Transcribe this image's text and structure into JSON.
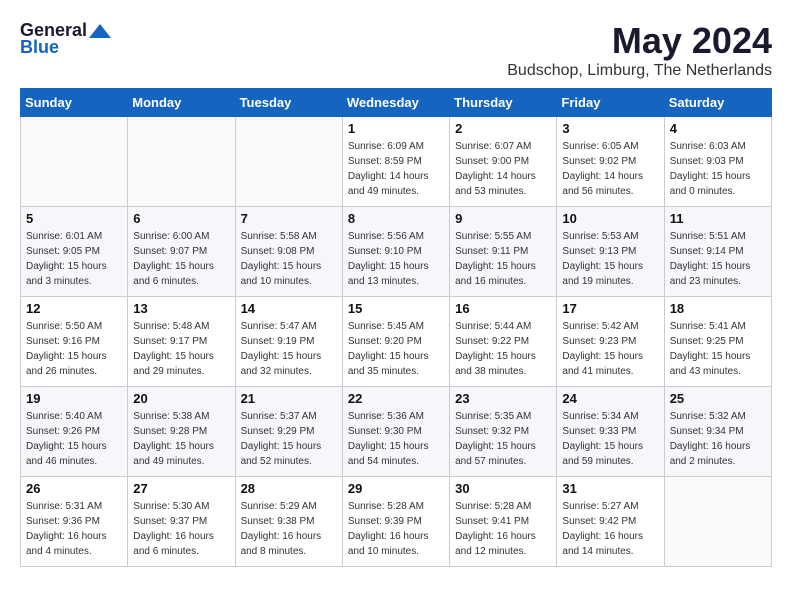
{
  "header": {
    "logo_general": "General",
    "logo_blue": "Blue",
    "month_title": "May 2024",
    "location": "Budschop, Limburg, The Netherlands"
  },
  "days_of_week": [
    "Sunday",
    "Monday",
    "Tuesday",
    "Wednesday",
    "Thursday",
    "Friday",
    "Saturday"
  ],
  "weeks": [
    [
      {
        "day": "",
        "info": ""
      },
      {
        "day": "",
        "info": ""
      },
      {
        "day": "",
        "info": ""
      },
      {
        "day": "1",
        "info": "Sunrise: 6:09 AM\nSunset: 8:59 PM\nDaylight: 14 hours\nand 49 minutes."
      },
      {
        "day": "2",
        "info": "Sunrise: 6:07 AM\nSunset: 9:00 PM\nDaylight: 14 hours\nand 53 minutes."
      },
      {
        "day": "3",
        "info": "Sunrise: 6:05 AM\nSunset: 9:02 PM\nDaylight: 14 hours\nand 56 minutes."
      },
      {
        "day": "4",
        "info": "Sunrise: 6:03 AM\nSunset: 9:03 PM\nDaylight: 15 hours\nand 0 minutes."
      }
    ],
    [
      {
        "day": "5",
        "info": "Sunrise: 6:01 AM\nSunset: 9:05 PM\nDaylight: 15 hours\nand 3 minutes."
      },
      {
        "day": "6",
        "info": "Sunrise: 6:00 AM\nSunset: 9:07 PM\nDaylight: 15 hours\nand 6 minutes."
      },
      {
        "day": "7",
        "info": "Sunrise: 5:58 AM\nSunset: 9:08 PM\nDaylight: 15 hours\nand 10 minutes."
      },
      {
        "day": "8",
        "info": "Sunrise: 5:56 AM\nSunset: 9:10 PM\nDaylight: 15 hours\nand 13 minutes."
      },
      {
        "day": "9",
        "info": "Sunrise: 5:55 AM\nSunset: 9:11 PM\nDaylight: 15 hours\nand 16 minutes."
      },
      {
        "day": "10",
        "info": "Sunrise: 5:53 AM\nSunset: 9:13 PM\nDaylight: 15 hours\nand 19 minutes."
      },
      {
        "day": "11",
        "info": "Sunrise: 5:51 AM\nSunset: 9:14 PM\nDaylight: 15 hours\nand 23 minutes."
      }
    ],
    [
      {
        "day": "12",
        "info": "Sunrise: 5:50 AM\nSunset: 9:16 PM\nDaylight: 15 hours\nand 26 minutes."
      },
      {
        "day": "13",
        "info": "Sunrise: 5:48 AM\nSunset: 9:17 PM\nDaylight: 15 hours\nand 29 minutes."
      },
      {
        "day": "14",
        "info": "Sunrise: 5:47 AM\nSunset: 9:19 PM\nDaylight: 15 hours\nand 32 minutes."
      },
      {
        "day": "15",
        "info": "Sunrise: 5:45 AM\nSunset: 9:20 PM\nDaylight: 15 hours\nand 35 minutes."
      },
      {
        "day": "16",
        "info": "Sunrise: 5:44 AM\nSunset: 9:22 PM\nDaylight: 15 hours\nand 38 minutes."
      },
      {
        "day": "17",
        "info": "Sunrise: 5:42 AM\nSunset: 9:23 PM\nDaylight: 15 hours\nand 41 minutes."
      },
      {
        "day": "18",
        "info": "Sunrise: 5:41 AM\nSunset: 9:25 PM\nDaylight: 15 hours\nand 43 minutes."
      }
    ],
    [
      {
        "day": "19",
        "info": "Sunrise: 5:40 AM\nSunset: 9:26 PM\nDaylight: 15 hours\nand 46 minutes."
      },
      {
        "day": "20",
        "info": "Sunrise: 5:38 AM\nSunset: 9:28 PM\nDaylight: 15 hours\nand 49 minutes."
      },
      {
        "day": "21",
        "info": "Sunrise: 5:37 AM\nSunset: 9:29 PM\nDaylight: 15 hours\nand 52 minutes."
      },
      {
        "day": "22",
        "info": "Sunrise: 5:36 AM\nSunset: 9:30 PM\nDaylight: 15 hours\nand 54 minutes."
      },
      {
        "day": "23",
        "info": "Sunrise: 5:35 AM\nSunset: 9:32 PM\nDaylight: 15 hours\nand 57 minutes."
      },
      {
        "day": "24",
        "info": "Sunrise: 5:34 AM\nSunset: 9:33 PM\nDaylight: 15 hours\nand 59 minutes."
      },
      {
        "day": "25",
        "info": "Sunrise: 5:32 AM\nSunset: 9:34 PM\nDaylight: 16 hours\nand 2 minutes."
      }
    ],
    [
      {
        "day": "26",
        "info": "Sunrise: 5:31 AM\nSunset: 9:36 PM\nDaylight: 16 hours\nand 4 minutes."
      },
      {
        "day": "27",
        "info": "Sunrise: 5:30 AM\nSunset: 9:37 PM\nDaylight: 16 hours\nand 6 minutes."
      },
      {
        "day": "28",
        "info": "Sunrise: 5:29 AM\nSunset: 9:38 PM\nDaylight: 16 hours\nand 8 minutes."
      },
      {
        "day": "29",
        "info": "Sunrise: 5:28 AM\nSunset: 9:39 PM\nDaylight: 16 hours\nand 10 minutes."
      },
      {
        "day": "30",
        "info": "Sunrise: 5:28 AM\nSunset: 9:41 PM\nDaylight: 16 hours\nand 12 minutes."
      },
      {
        "day": "31",
        "info": "Sunrise: 5:27 AM\nSunset: 9:42 PM\nDaylight: 16 hours\nand 14 minutes."
      },
      {
        "day": "",
        "info": ""
      }
    ]
  ]
}
